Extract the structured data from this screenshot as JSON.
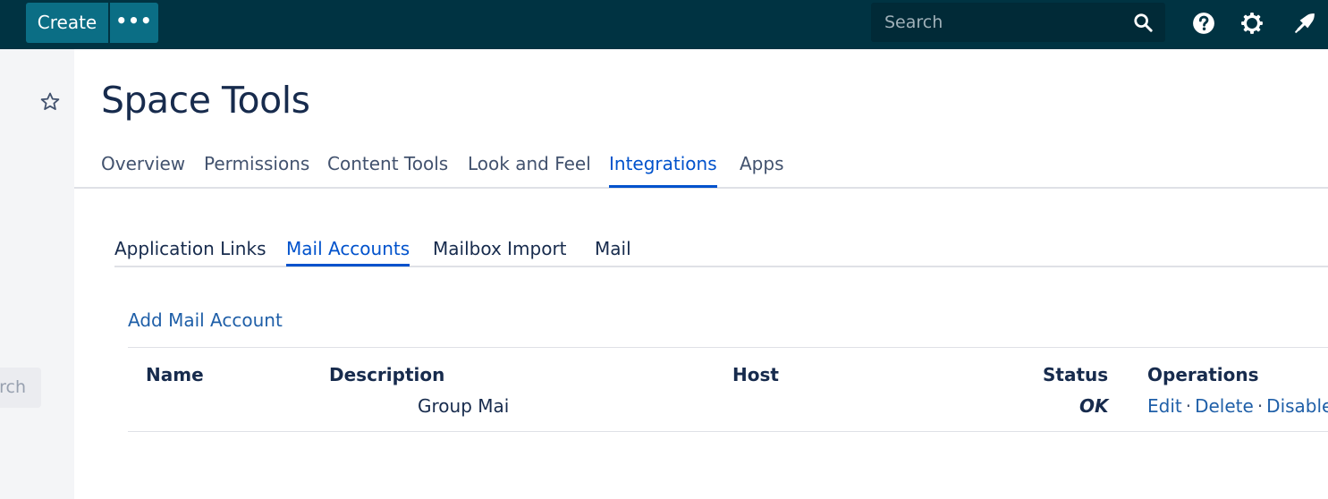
{
  "topbar": {
    "create_label": "Create",
    "more_label": "•••",
    "search_placeholder": "Search"
  },
  "sidebar": {
    "search_text": "Search"
  },
  "page": {
    "title": "Space Tools"
  },
  "tabs": [
    {
      "label": "Overview",
      "active": false
    },
    {
      "label": "Permissions",
      "active": false
    },
    {
      "label": "Content Tools",
      "active": false
    },
    {
      "label": "Look and Feel",
      "active": false
    },
    {
      "label": "Integrations",
      "active": true
    },
    {
      "label": "Apps",
      "active": false
    }
  ],
  "subtabs": [
    {
      "label": "Application Links",
      "active": false
    },
    {
      "label": "Mail Accounts",
      "active": true
    },
    {
      "label": "Mailbox Import",
      "active": false
    },
    {
      "label": "Mail",
      "active": false
    }
  ],
  "add_mail_account": "Add Mail Account",
  "table": {
    "headers": {
      "name": "Name",
      "description": "Description",
      "host": "Host",
      "status": "Status",
      "operations": "Operations"
    },
    "rows": [
      {
        "name": "",
        "description": "Group Mai",
        "host": "",
        "status": "OK",
        "ops": {
          "edit": "Edit",
          "delete": "Delete",
          "disable": "Disable"
        }
      }
    ]
  },
  "colors": {
    "topbar": "#003342",
    "button": "#0b6e85",
    "link": "#1f5fa8",
    "active_tab": "#0052cc"
  }
}
